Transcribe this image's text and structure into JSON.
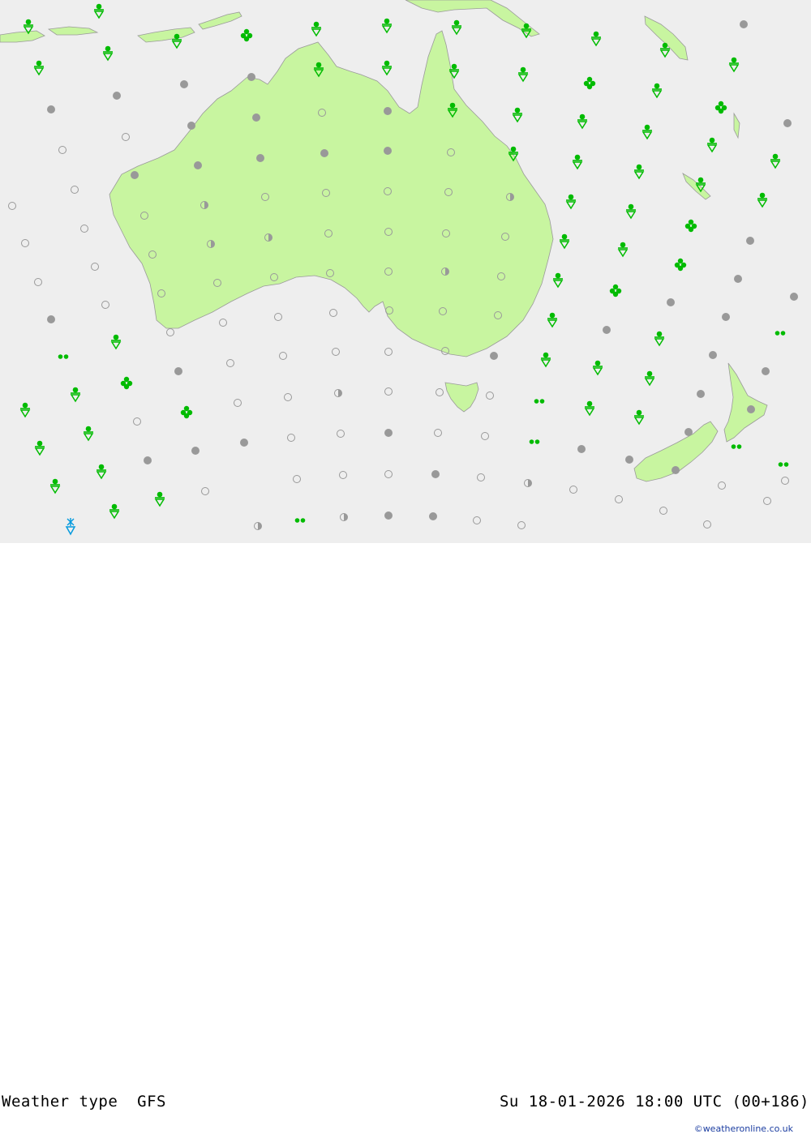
{
  "footer": {
    "title": "Weather type  GFS",
    "datetime": "Su 18-01-2026 18:00 UTC (00+186)",
    "credit": "©weatheronline.co.uk"
  },
  "colors": {
    "sea": "#eeeeee",
    "land": "#c8f5a0",
    "coast": "#9a9a9a",
    "rain": "#00bb00",
    "snow": "#0099dd",
    "overcast": "#999999"
  },
  "symbol_types": [
    "rain-shower",
    "showers",
    "drizzle",
    "cloudy",
    "partly-cloudy",
    "clear",
    "snow-shower"
  ],
  "symbol_counts": {
    "rain-shower": 62,
    "showers": 8,
    "drizzle": 8,
    "cloudy": 43,
    "partly-cloudy": 10,
    "clear": 74,
    "snow-shower": 1
  }
}
